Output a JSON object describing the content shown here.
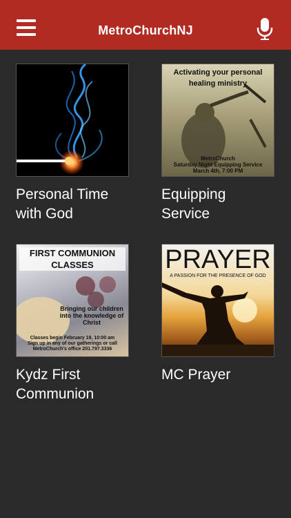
{
  "header": {
    "title": "MetroChurchNJ",
    "menu_icon": "hamburger-menu-icon",
    "mic_icon": "microphone-icon",
    "bg_color": "#b22b22"
  },
  "tiles": [
    {
      "caption": "Personal Time with God"
    },
    {
      "caption": "Equipping Service",
      "image_text": {
        "heading": "Activating your personal healing ministry",
        "line1": "MetroChurch",
        "line2": "Saturday Night Equipping Service",
        "line3": "March 4th, 7:00 PM"
      }
    },
    {
      "caption": "Kydz First Communion",
      "image_text": {
        "heading": "FIRST COMMUNION CLASSES",
        "middle": "Bringing our children into the knowledge of Christ",
        "line1": "Classes begin February 19, 10:00 am",
        "line2": "Sign up in any of our gatherings or call",
        "line3": "MetroChurch's office 201.797.3336"
      }
    },
    {
      "caption": "MC Prayer",
      "image_text": {
        "heading": "PRAYER",
        "sub": "A PASSION FOR THE PRESENCE OF GOD"
      }
    }
  ]
}
